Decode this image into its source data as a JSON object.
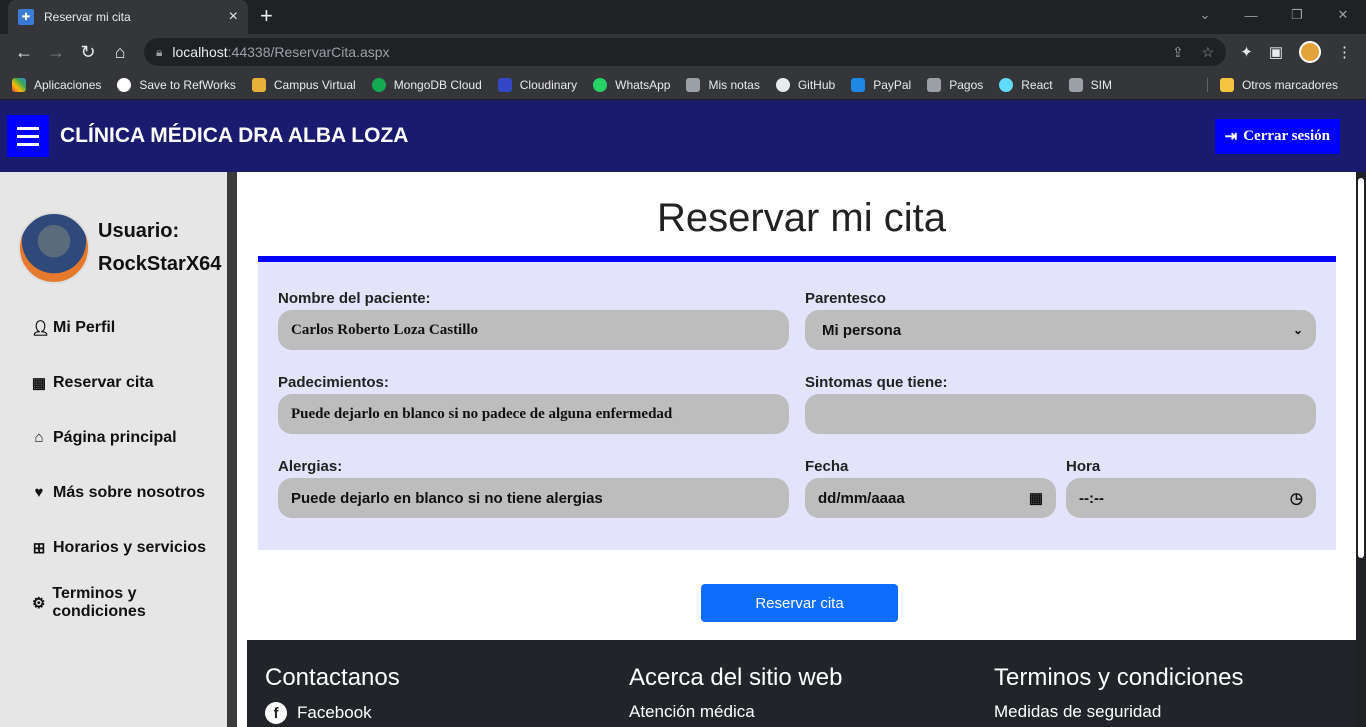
{
  "browser": {
    "tab_title": "Reservar mi cita",
    "url_host": "localhost",
    "url_path": ":44338/ReservarCita.aspx",
    "bookmarks": [
      "Aplicaciones",
      "Save to RefWorks",
      "Campus Virtual",
      "MongoDB Cloud",
      "Cloudinary",
      "WhatsApp",
      "Mis notas",
      "GitHub",
      "PayPal",
      "Pagos",
      "React",
      "SIM"
    ],
    "other_bookmarks": "Otros marcadores"
  },
  "header": {
    "brand": "CLÍNICA MÉDICA DRA ALBA LOZA",
    "logout": "Cerrar sesión"
  },
  "sidebar": {
    "user_label": "Usuario:",
    "username": "RockStarX64",
    "items": [
      {
        "label": "Mi Perfil",
        "icon": "user-icon"
      },
      {
        "label": "Reservar cita",
        "icon": "calendar-icon"
      },
      {
        "label": "Página principal",
        "icon": "home-icon"
      },
      {
        "label": "Más sobre nosotros",
        "icon": "hands-icon"
      },
      {
        "label": "Horarios y servicios",
        "icon": "sitemap-icon"
      },
      {
        "label": "Terminos y condiciones",
        "icon": "gear-icon"
      }
    ]
  },
  "main": {
    "title": "Reservar mi cita",
    "form": {
      "patient_label": "Nombre del paciente:",
      "patient_value": "Carlos Roberto Loza Castillo",
      "relation_label": "Parentesco",
      "relation_value": "Mi persona",
      "conditions_label": "Padecimientos:",
      "conditions_placeholder": "Puede dejarlo en blanco si no padece de alguna enfermedad",
      "symptoms_label": "Sintomas que tiene:",
      "symptoms_value": "",
      "allergies_label": "Alergias:",
      "allergies_placeholder": "Puede dejarlo en blanco si no tiene alergias",
      "date_label": "Fecha",
      "date_value": "dd/mm/aaaa",
      "time_label": "Hora",
      "time_value": "--:--"
    },
    "submit": "Reservar cita"
  },
  "footer": {
    "contact_title": "Contactanos",
    "contact_link": "Facebook",
    "about_title": "Acerca del sitio web",
    "about_link": "Atención médica",
    "terms_title": "Terminos y condiciones",
    "terms_link": "Medidas de seguridad"
  },
  "colors": {
    "header_bg": "#1a1a6e",
    "accent_blue": "#0000ff",
    "submit_blue": "#0d6efd",
    "form_bg": "#e3e3fb"
  }
}
